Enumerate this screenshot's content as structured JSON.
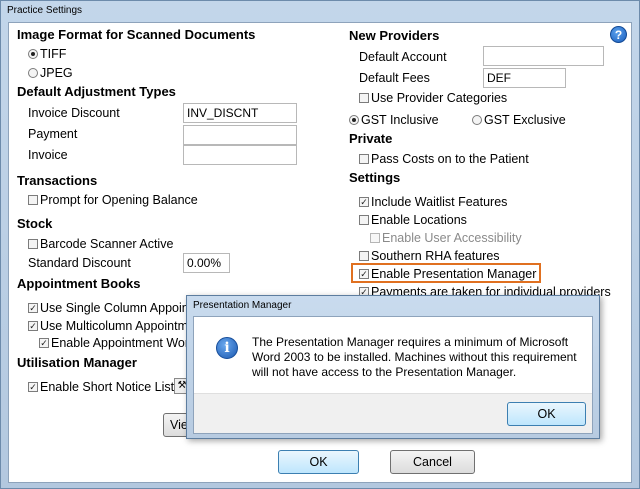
{
  "window": {
    "title": "Practice Settings"
  },
  "left": {
    "image_format": {
      "header": "Image Format for Scanned Documents",
      "tiff": "TIFF",
      "jpeg": "JPEG",
      "selected": "TIFF"
    },
    "adjustment": {
      "header": "Default Adjustment Types",
      "invoice_discount_label": "Invoice Discount",
      "invoice_discount_value": "INV_DISCNT",
      "payment_label": "Payment",
      "payment_value": "",
      "invoice_label": "Invoice",
      "invoice_value": ""
    },
    "transactions": {
      "header": "Transactions",
      "prompt_opening": "Prompt for Opening Balance",
      "prompt_opening_checked": false
    },
    "stock": {
      "header": "Stock",
      "barcode": "Barcode Scanner Active",
      "barcode_checked": false,
      "std_discount_label": "Standard Discount",
      "std_discount_value": "0.00%"
    },
    "appointment_books": {
      "header": "Appointment Books",
      "single_column": "Use Single Column Appointm",
      "single_column_checked": true,
      "multicolumn": "Use Multicolumn Appointmen",
      "multicolumn_checked": true,
      "enable_workflow": "Enable Appointment Workf",
      "enable_workflow_checked": true
    },
    "utilisation": {
      "header": "Utilisation Manager",
      "short_notice": "Enable Short Notice List",
      "short_notice_checked": true,
      "view_button": "Vie"
    }
  },
  "right": {
    "new_providers": {
      "header": "New Providers",
      "default_account_label": "Default Account",
      "default_account_value": "",
      "default_fees_label": "Default Fees",
      "default_fees_value": "DEF",
      "use_categories": "Use Provider Categories",
      "use_categories_checked": false,
      "gst_inclusive": "GST Inclusive",
      "gst_exclusive": "GST Exclusive",
      "gst_selected": "GST Inclusive"
    },
    "private": {
      "header": "Private",
      "pass_costs": "Pass Costs on to the Patient",
      "pass_costs_checked": false
    },
    "settings": {
      "header": "Settings",
      "waitlist": "Include Waitlist Features",
      "waitlist_checked": true,
      "locations": "Enable Locations",
      "locations_checked": false,
      "user_access": "Enable User Accessibility",
      "user_access_checked": false,
      "southern_rha": "Southern RHA features",
      "southern_rha_checked": false,
      "presentation": "Enable Presentation Manager",
      "presentation_checked": true,
      "payments_individual": "Payments are taken for individual providers",
      "payments_individual_checked": true
    }
  },
  "footer": {
    "ok": "OK",
    "cancel": "Cancel"
  },
  "dialog": {
    "title": "Presentation Manager",
    "message": "The Presentation Manager requires a minimum of Microsoft Word 2003 to be installed. Machines without this requirement will not have access to the Presentation Manager.",
    "ok": "OK",
    "icon": "info-icon"
  },
  "colors": {
    "highlight": "#e07020",
    "accent": "#1b5fbe"
  },
  "check_mark": "✓"
}
